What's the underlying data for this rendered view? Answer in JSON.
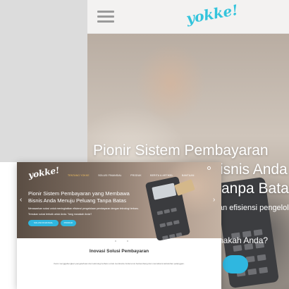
{
  "mobile": {
    "logo": "yokke!",
    "hero_title_lines": [
      "Pionir Sistem Pembayaran",
      "Bisnis Anda",
      "anpa Batas"
    ],
    "hero_sub": "an efisiensi pengelola",
    "hero_question": "nakah Anda?"
  },
  "desktop": {
    "logo": "yokke!",
    "nav": [
      "TENTANG YOKKE",
      "SOLUSI FINANSIAL",
      "PRODUK",
      "BERITA & ARTIKEL",
      "BANTUAN"
    ],
    "hero": {
      "title_line1": "Pionir Sistem Pembayaran yang Membawa",
      "title_line2": "Bisnis Anda Menuju Peluang Tanpa Batas",
      "sub": "Menawarkan solusi untuk meningkatkan efisiensi pengelolaan pembayaran dengan teknologi terbaru.",
      "question": "Temukan solusi terbaik untuk Anda. Yang manakah Anda?",
      "primary_button": "SOLUSI FINANSIAL",
      "secondary_button": "PRODUK"
    },
    "section": {
      "title": "Inovasi Solusi Pembayaran",
      "text": "Kami menggabungkan pengetahuan dan teknologi terbaru untuk membantu Anda terus berkembang dan memahami kebutuhan pelanggan."
    }
  },
  "colors": {
    "accent": "#2fb7e0",
    "logo": "#33c4dc"
  }
}
